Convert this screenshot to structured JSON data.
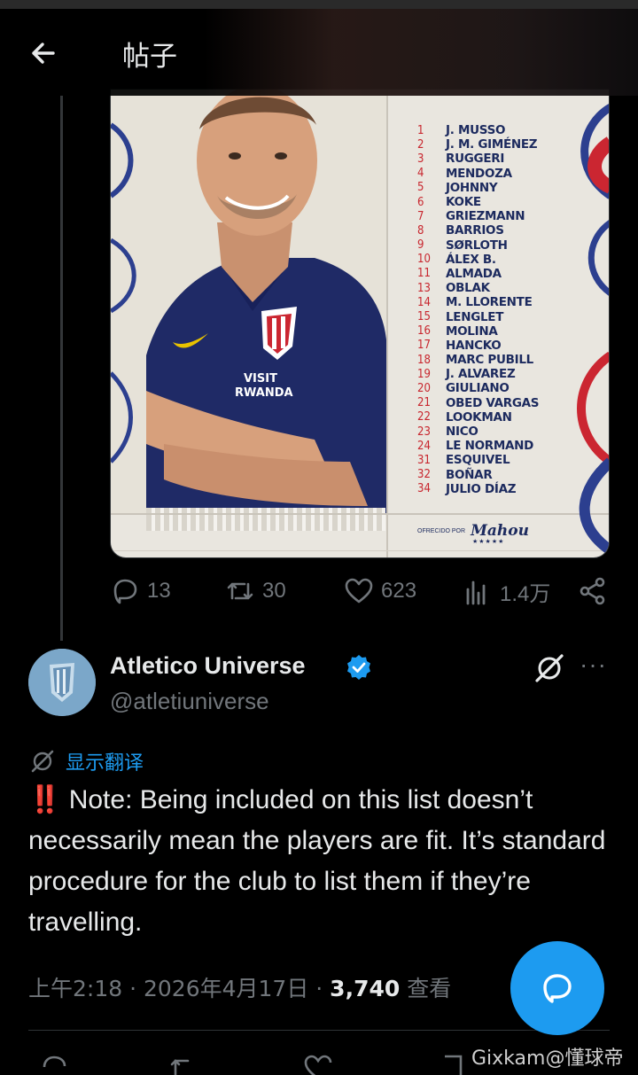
{
  "header": {
    "title": "帖子",
    "back_icon": "arrow-left-icon"
  },
  "media": {
    "shirt_text": "VISIT\nRWANDA",
    "squad": [
      {
        "num": "1",
        "name": "J. MUSSO"
      },
      {
        "num": "2",
        "name": "J. M. GIMÉNEZ"
      },
      {
        "num": "3",
        "name": "RUGGERI"
      },
      {
        "num": "4",
        "name": "MENDOZA"
      },
      {
        "num": "5",
        "name": "JOHNNY"
      },
      {
        "num": "6",
        "name": "KOKE"
      },
      {
        "num": "7",
        "name": "GRIEZMANN"
      },
      {
        "num": "8",
        "name": "BARRIOS"
      },
      {
        "num": "9",
        "name": "SØRLOTH"
      },
      {
        "num": "10",
        "name": "ÁLEX B."
      },
      {
        "num": "11",
        "name": "ALMADA"
      },
      {
        "num": "13",
        "name": "OBLAK"
      },
      {
        "num": "14",
        "name": "M. LLORENTE"
      },
      {
        "num": "15",
        "name": "LENGLET"
      },
      {
        "num": "16",
        "name": "MOLINA"
      },
      {
        "num": "17",
        "name": "HANCKO"
      },
      {
        "num": "18",
        "name": "MARC PUBILL"
      },
      {
        "num": "19",
        "name": "J. ALVAREZ"
      },
      {
        "num": "20",
        "name": "GIULIANO"
      },
      {
        "num": "21",
        "name": "OBED VARGAS"
      },
      {
        "num": "22",
        "name": "LOOKMAN"
      },
      {
        "num": "23",
        "name": "NICO"
      },
      {
        "num": "24",
        "name": "LE NORMAND"
      },
      {
        "num": "31",
        "name": "ESQUIVEL"
      },
      {
        "num": "32",
        "name": "BOÑAR"
      },
      {
        "num": "34",
        "name": "JULIO DÍAZ"
      }
    ],
    "sponsor_small": "OFRECIDO POR",
    "sponsor_brand": "Mahou",
    "sponsor_stars": "★★★★★"
  },
  "actions": {
    "replies": "13",
    "reposts": "30",
    "likes": "623",
    "views": "1.4万"
  },
  "author": {
    "name": "Atletico Universe",
    "handle": "@atletiuniverse"
  },
  "translate_label": "显示翻译",
  "tweet": {
    "bang": "‼️",
    "text": " Note: Being included on this list doesn’t necessarily mean the players are fit. It’s standard procedure for the club to list them if they’re travelling."
  },
  "meta": {
    "time": "上午2:18 · 2026年4月17日 · ",
    "views_count": "3,740",
    "views_label": " 查看"
  },
  "watermark": "Gixkam@懂球帝",
  "colors": {
    "accent": "#1d9bf0",
    "muted": "#71767b",
    "squad_navy": "#1c2a5e",
    "squad_red": "#c8262e"
  }
}
